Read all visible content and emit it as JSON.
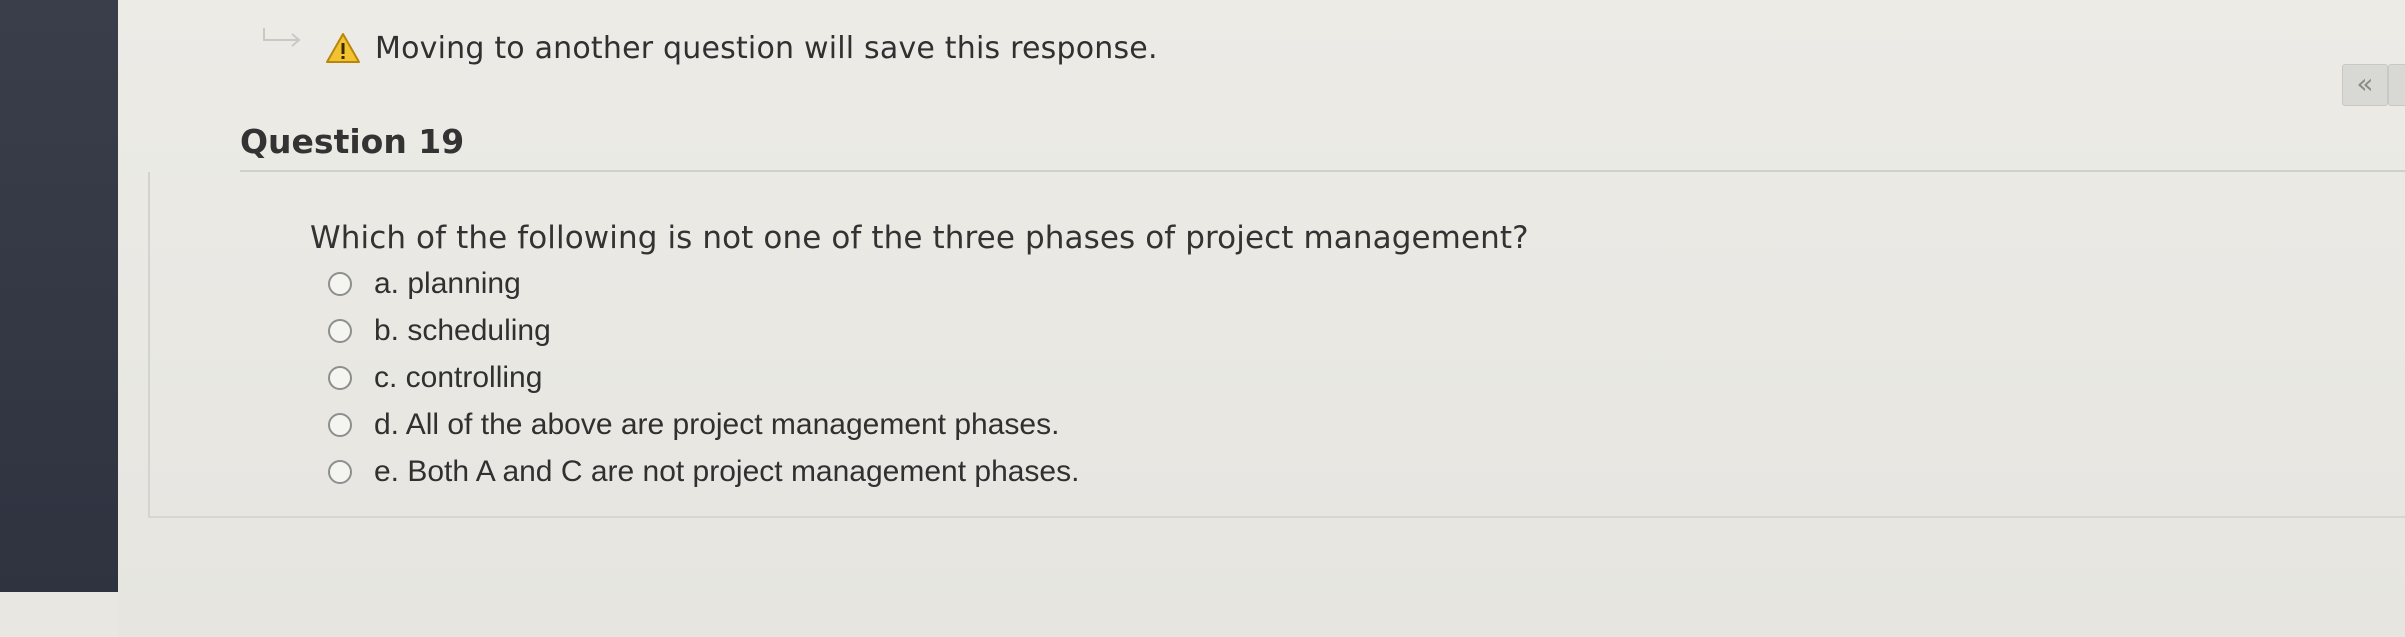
{
  "warning": {
    "text": "Moving to another question will save this response.",
    "icon": "warning-triangle-icon",
    "icon_color": "#d9a21b"
  },
  "question": {
    "title": "Question 19",
    "prompt": "Which of the following is not one of the three phases of project management?",
    "options": [
      {
        "label": "a. planning",
        "selected": false
      },
      {
        "label": "b. scheduling",
        "selected": false
      },
      {
        "label": "c. controlling",
        "selected": false
      },
      {
        "label": "d. All of the above are project management phases.",
        "selected": false
      },
      {
        "label": "e. Both A and C are not project management phases.",
        "selected": false
      }
    ]
  },
  "sidebar_toggle": {
    "label": "«",
    "icon": "double-chevron-left-icon"
  }
}
